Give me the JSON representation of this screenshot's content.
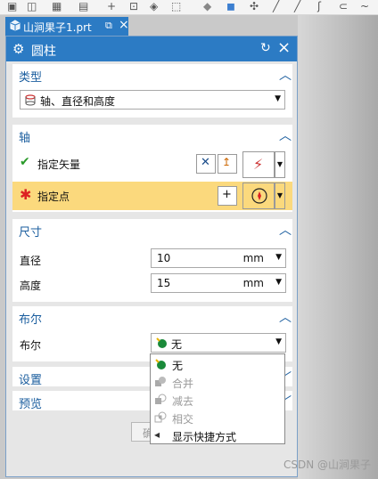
{
  "tab": {
    "title": "山涧果子1.prt"
  },
  "dialog": {
    "title": "圆柱",
    "type_group": {
      "title": "类型",
      "selected": "轴、直径和高度"
    },
    "axis_group": {
      "title": "轴",
      "vector_label": "指定矢量",
      "point_label": "指定点"
    },
    "size_group": {
      "title": "尺寸",
      "diameter_label": "直径",
      "diameter_value": "10",
      "diameter_unit": "mm",
      "height_label": "高度",
      "height_value": "15",
      "height_unit": "mm"
    },
    "bool_group": {
      "title": "布尔",
      "label": "布尔",
      "selected": "无"
    },
    "settings_title": "设置",
    "preview_title": "预览",
    "ok_partial": "确"
  },
  "bool_options": [
    "无",
    "合并",
    "减去",
    "相交",
    "显示快捷方式"
  ],
  "watermark": "CSDN @山涧果子"
}
